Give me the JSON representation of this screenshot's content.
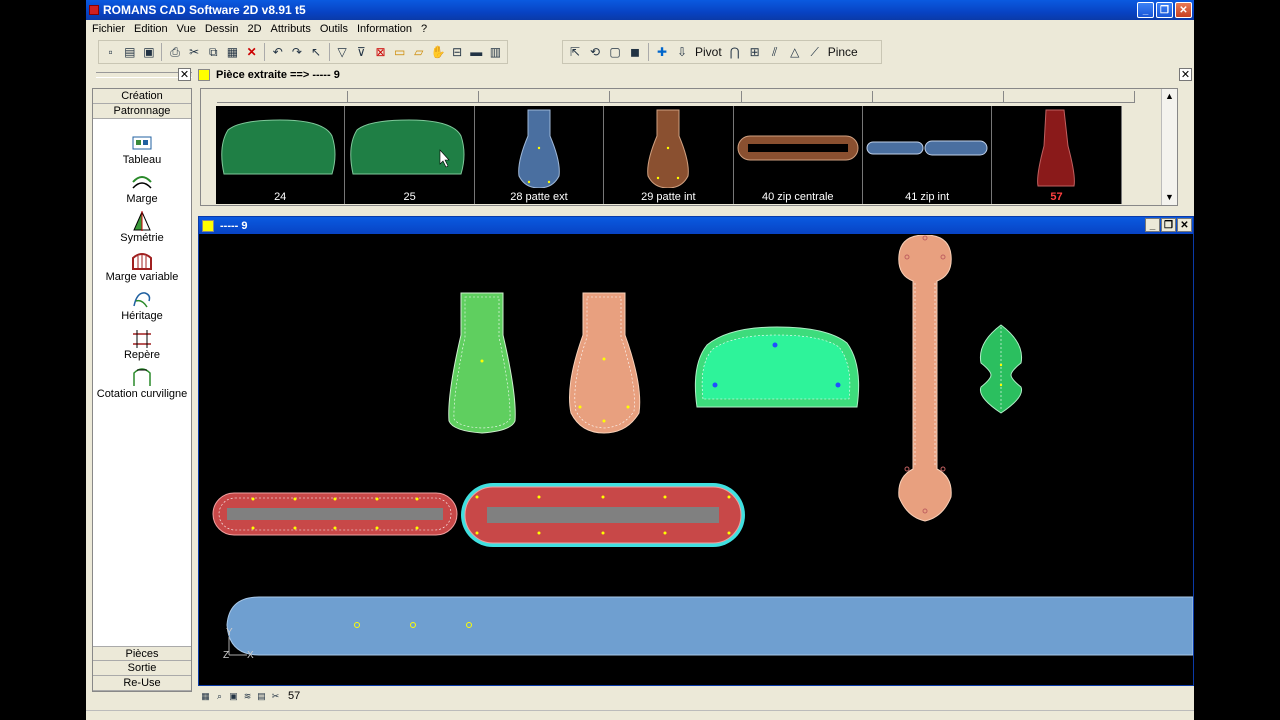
{
  "window": {
    "title": "ROMANS CAD Software 2D v8.91 t5",
    "buttons": [
      "_",
      "❐",
      "✕"
    ]
  },
  "menu": [
    "Fichier",
    "Edition",
    "Vue",
    "Dessin",
    "2D",
    "Attributs",
    "Outils",
    "Information",
    "?"
  ],
  "toolbar2": {
    "pivot_label": "Pivot",
    "pince_label": "Pince"
  },
  "piece_bar": {
    "label": "Pièce extraite ==>  ----- 9",
    "close": "✕"
  },
  "left_panel": {
    "close": "✕",
    "top_tabs": [
      "Création",
      "Patronnage"
    ],
    "tools": [
      {
        "label": "Tableau",
        "icon": "table-icon"
      },
      {
        "label": "Marge",
        "icon": "margin-icon"
      },
      {
        "label": "Symétrie",
        "icon": "symmetry-icon"
      },
      {
        "label": "Marge variable",
        "icon": "variable-margin-icon"
      },
      {
        "label": "Héritage",
        "icon": "inheritance-icon"
      },
      {
        "label": "Repère",
        "icon": "notch-icon"
      },
      {
        "label": "Cotation curviligne",
        "icon": "curvilinear-dimension-icon"
      }
    ],
    "bottom_tabs": [
      "Pièces",
      "Sortie",
      "Re-Use"
    ]
  },
  "thumbnails": [
    {
      "label": "24",
      "color": "#1f7f45",
      "shape": "bag"
    },
    {
      "label": "25",
      "color": "#1f7f45",
      "shape": "bag"
    },
    {
      "label": "28   patte ext",
      "color": "#4a6fa0",
      "shape": "tab"
    },
    {
      "label": "29   patte int",
      "color": "#8a5030",
      "shape": "tab"
    },
    {
      "label": "40   zip centrale",
      "color": "#8a5030",
      "shape": "zip"
    },
    {
      "label": "41   zip int",
      "color": "#4a6fa0",
      "shape": "zip2"
    },
    {
      "label": "57",
      "color": "#8a1a1a",
      "shape": "cone",
      "highlight": true
    }
  ],
  "draw_window": {
    "title": "----- 9",
    "buttons": [
      "_",
      "❐",
      "✕"
    ]
  },
  "axes": {
    "y": "Y",
    "z": "Z",
    "x": "X"
  },
  "status": {
    "value": "57"
  }
}
